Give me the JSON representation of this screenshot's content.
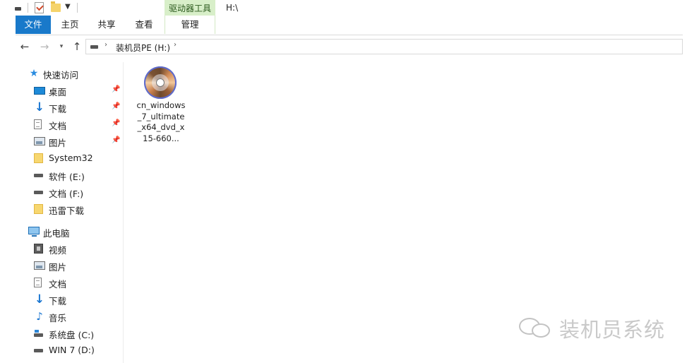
{
  "titlebar": {
    "tools_tab_label": "驱动器工具",
    "window_title": "H:\\"
  },
  "ribbon": {
    "tabs": [
      {
        "label": "文件"
      },
      {
        "label": "主页"
      },
      {
        "label": "共享"
      },
      {
        "label": "查看"
      },
      {
        "label": "管理"
      }
    ]
  },
  "address": {
    "location": "装机员PE (H:)"
  },
  "sidebar": {
    "quick_access_label": "快速访问",
    "quick_items": [
      {
        "label": "桌面",
        "icon": "desktop-icon",
        "pinned": true
      },
      {
        "label": "下载",
        "icon": "download-icon",
        "pinned": true
      },
      {
        "label": "文档",
        "icon": "document-icon",
        "pinned": true
      },
      {
        "label": "图片",
        "icon": "picture-icon",
        "pinned": true
      },
      {
        "label": "System32",
        "icon": "folder-icon",
        "pinned": false
      },
      {
        "label": "软件 (E:)",
        "icon": "drive-icon",
        "pinned": false
      },
      {
        "label": "文档 (F:)",
        "icon": "drive-icon",
        "pinned": false
      },
      {
        "label": "迅雷下载",
        "icon": "folder-icon",
        "pinned": false
      }
    ],
    "this_pc_label": "此电脑",
    "pc_items": [
      {
        "label": "视频",
        "icon": "video-icon"
      },
      {
        "label": "图片",
        "icon": "picture-icon"
      },
      {
        "label": "文档",
        "icon": "document-icon"
      },
      {
        "label": "下载",
        "icon": "download-icon"
      },
      {
        "label": "音乐",
        "icon": "music-icon"
      },
      {
        "label": "系统盘 (C:)",
        "icon": "system-drive-icon"
      },
      {
        "label": "WIN 7 (D:)",
        "icon": "drive-icon"
      }
    ]
  },
  "files": [
    {
      "name": "cn_windows_7_ultimate_x64_dvd_x15-660...",
      "icon": "disc-image-icon"
    }
  ],
  "watermark": {
    "text": "装机员系统"
  },
  "colors": {
    "file_tab": "#1979ca",
    "tools_tab": "#d8efc9",
    "pin": "#8a8a8a"
  }
}
